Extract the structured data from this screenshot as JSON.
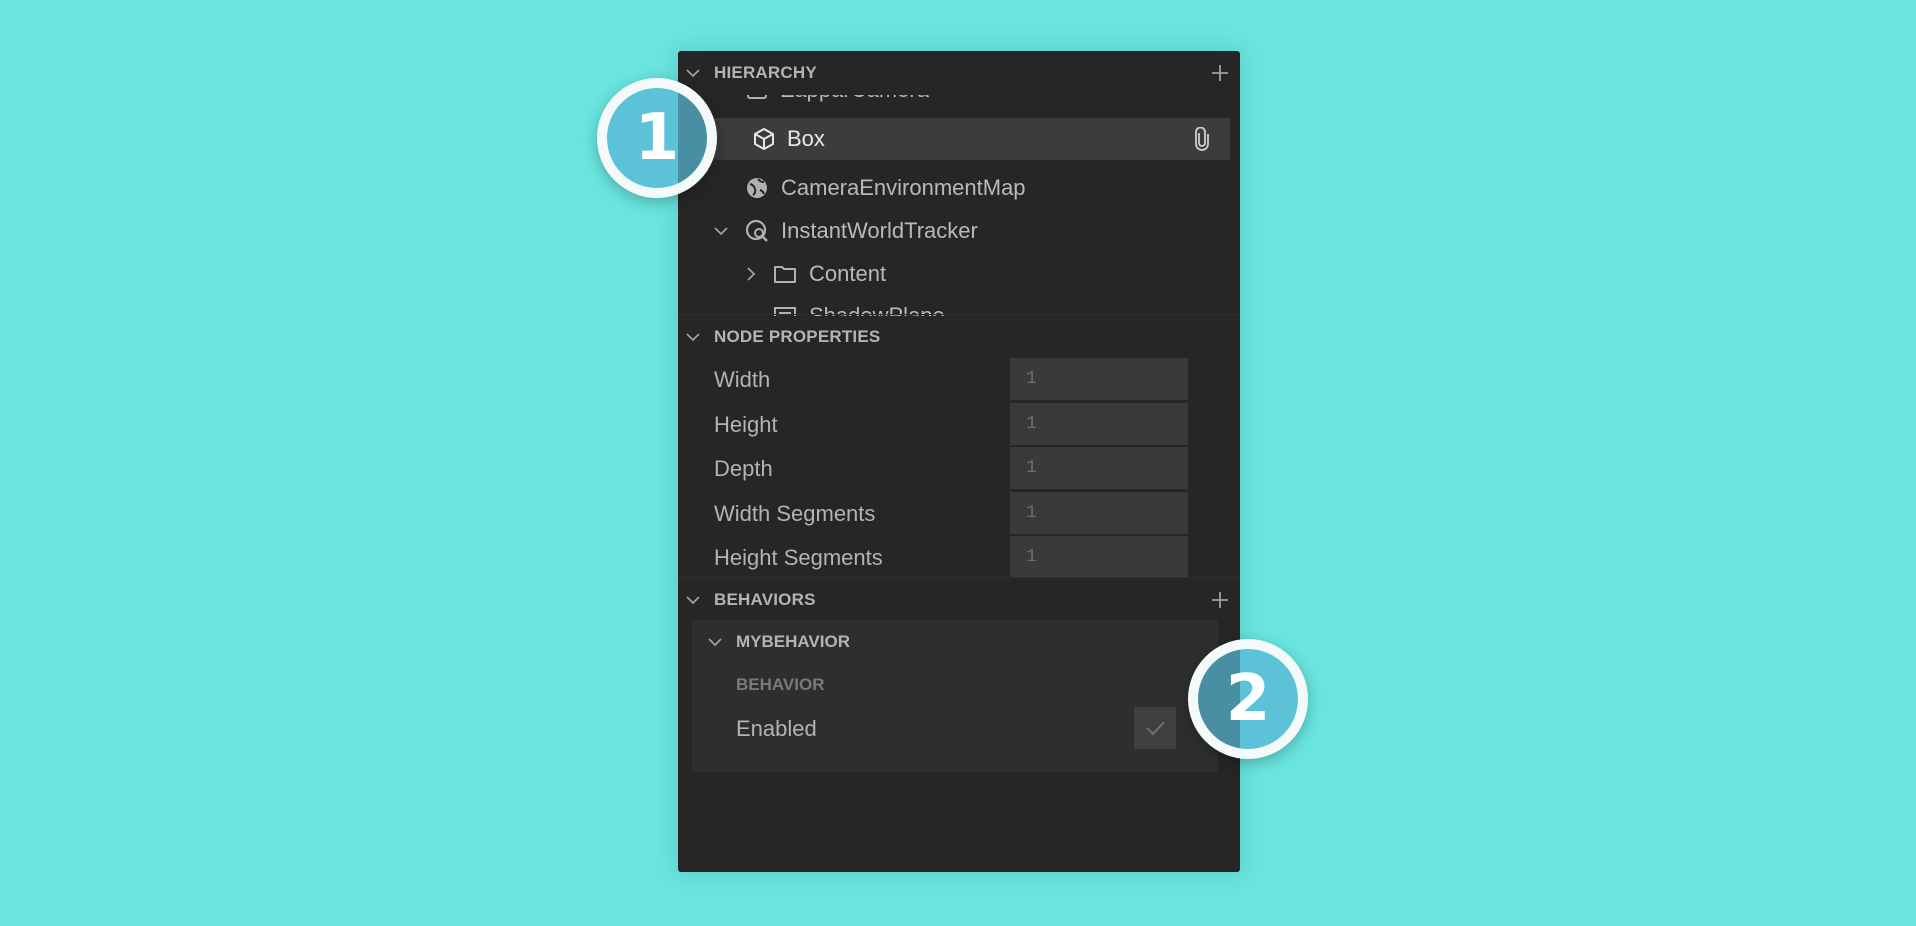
{
  "hierarchy": {
    "title": "HIERARCHY",
    "items": [
      {
        "label": "ZapparCamera",
        "icon": "camera-icon"
      },
      {
        "label": "Box",
        "icon": "cube-icon",
        "selected": true,
        "badge_icon": "paperclip-icon"
      },
      {
        "label": "CameraEnvironmentMap",
        "icon": "globe-icon"
      },
      {
        "label": "InstantWorldTracker",
        "icon": "world-tracker-icon"
      },
      {
        "label": "Content",
        "icon": "folder-icon"
      },
      {
        "label": "ShadowPlane",
        "icon": "plane-icon"
      }
    ]
  },
  "node_properties": {
    "title": "NODE PROPERTIES",
    "fields": [
      {
        "label": "Width",
        "value": "1"
      },
      {
        "label": "Height",
        "value": "1"
      },
      {
        "label": "Depth",
        "value": "1"
      },
      {
        "label": "Width Segments",
        "value": "1"
      },
      {
        "label": "Height Segments",
        "value": "1"
      }
    ]
  },
  "behaviors": {
    "title": "BEHAVIORS",
    "card": {
      "title": "MYBEHAVIOR",
      "subtitle": "BEHAVIOR",
      "enabled_label": "Enabled",
      "enabled_checked": true
    }
  },
  "markers": [
    {
      "number": "1"
    },
    {
      "number": "2"
    }
  ],
  "colors": {
    "background": "#69e4df",
    "panel": "#262626",
    "marker_fill": "#58bcd3"
  }
}
